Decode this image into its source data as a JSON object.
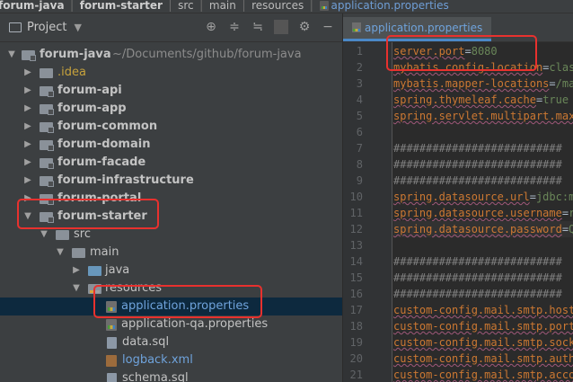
{
  "breadcrumb": {
    "items": [
      "forum-java",
      "forum-starter",
      "src",
      "main",
      "resources"
    ],
    "file": "application.properties"
  },
  "project_panel": {
    "title": "Project",
    "root": {
      "name": "forum-java",
      "path": "~/Documents/github/forum-java"
    },
    "items": [
      {
        "label": ".idea",
        "kind": "idea"
      },
      {
        "label": "forum-api"
      },
      {
        "label": "forum-app"
      },
      {
        "label": "forum-common"
      },
      {
        "label": "forum-domain"
      },
      {
        "label": "forum-facade"
      },
      {
        "label": "forum-infrastructure"
      },
      {
        "label": "forum-portal"
      },
      {
        "label": "forum-starter"
      },
      {
        "label": "src"
      },
      {
        "label": "main"
      },
      {
        "label": "java"
      },
      {
        "label": "resources"
      },
      {
        "label": "application.properties"
      },
      {
        "label": "application-qa.properties"
      },
      {
        "label": "data.sql"
      },
      {
        "label": "logback.xml"
      },
      {
        "label": "schema.sql"
      }
    ],
    "toolbar_icons": [
      "locate-icon",
      "collapse-all-icon",
      "expand-icon",
      "gear-icon",
      "minimize-icon"
    ]
  },
  "editor": {
    "tab_label": "application.properties",
    "line_numbers": [
      "1",
      "2",
      "3",
      "4",
      "5",
      "6",
      "7",
      "8",
      "9",
      "10",
      "11",
      "12",
      "13",
      "14",
      "15",
      "16",
      "17",
      "18",
      "19",
      "20",
      "21"
    ],
    "lines": [
      {
        "key": "server.port",
        "value": "8080"
      },
      {
        "key": "mybatis.config-location",
        "value": "clas"
      },
      {
        "key": "mybatis.mapper-locations",
        "value": "/ma"
      },
      {
        "key": "spring.thymeleaf.cache",
        "value": "true"
      },
      {
        "key": "spring.servlet.multipart.max",
        "value": ""
      },
      {
        "key": "",
        "value": ""
      },
      {
        "comment": "##########################"
      },
      {
        "comment": "##########################"
      },
      {
        "comment": "##########################"
      },
      {
        "key": "spring.datasource.url",
        "value": "jdbc:m"
      },
      {
        "key": "spring.datasource.username",
        "value": "r"
      },
      {
        "key": "spring.datasource.password",
        "value": "Q"
      },
      {
        "key": "",
        "value": ""
      },
      {
        "comment": "##########################"
      },
      {
        "comment": "##########################"
      },
      {
        "comment": "##########################"
      },
      {
        "key": "custom-config.mail.smtp.host",
        "value": ""
      },
      {
        "key": "custom-config.mail.smtp.port",
        "value": ""
      },
      {
        "key": "custom-config.mail.smtp.sock",
        "value": ""
      },
      {
        "key": "custom-config.mail.smtp.auth",
        "value": ""
      },
      {
        "key": "custom-config.mail.smtp.acco",
        "value": ""
      }
    ],
    "current_line": "12"
  },
  "colors": {
    "highlight_box": "#e8312e",
    "selection": "#0d293e",
    "property_key": "#cc7832",
    "property_value": "#6a8759"
  }
}
